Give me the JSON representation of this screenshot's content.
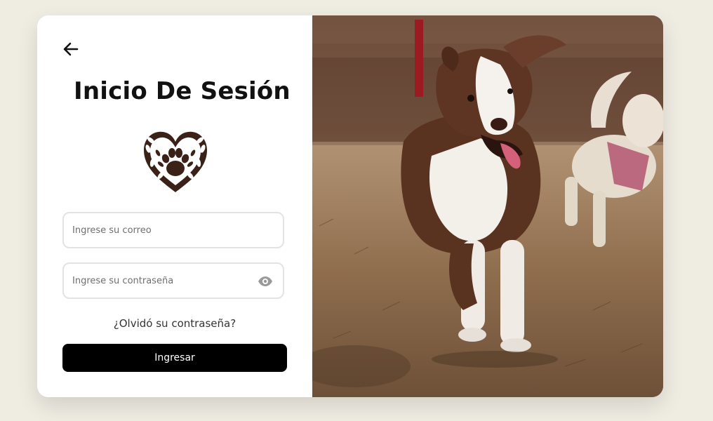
{
  "login": {
    "title": "Inicio De Sesión",
    "email_placeholder": "Ingrese su correo",
    "password_placeholder": "Ingrese su contraseña",
    "forgot_label": "¿Olvidó su contraseña?",
    "submit_label": "Ingresar"
  },
  "icons": {
    "back": "arrow-left-icon",
    "logo": "paw-heart-logo",
    "password_toggle": "eye-icon"
  },
  "colors": {
    "page_background": "#efece2",
    "card_background": "#ffffff",
    "button_background": "#000000",
    "button_text": "#ffffff",
    "logo_color": "#3a2218"
  }
}
